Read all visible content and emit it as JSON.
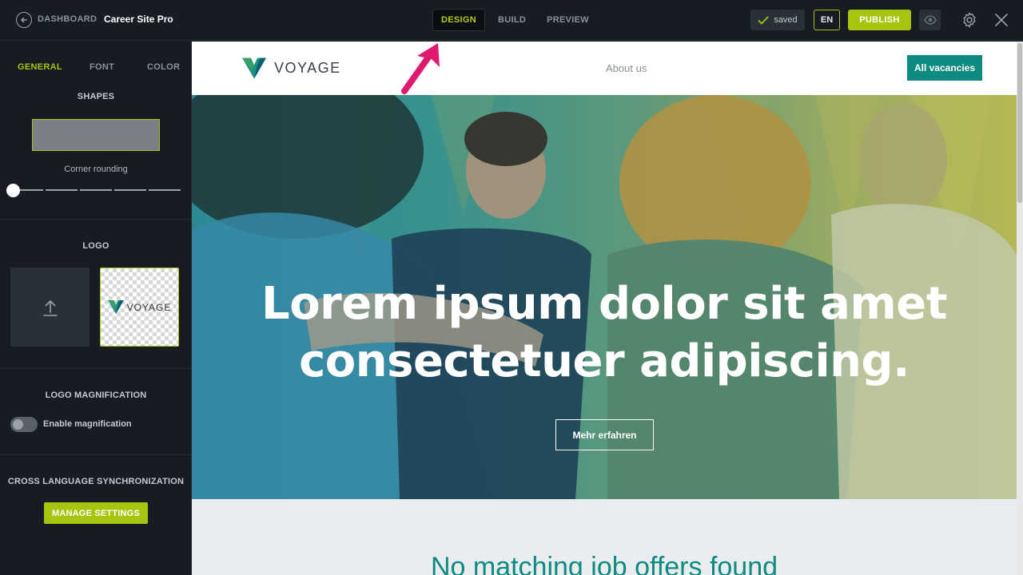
{
  "topbar": {
    "back_label": "DASHBOARD",
    "app_title": "Career Site Pro",
    "modes": [
      {
        "label": "DESIGN",
        "active": true
      },
      {
        "label": "BUILD",
        "active": false
      },
      {
        "label": "PREVIEW",
        "active": false
      }
    ],
    "saved_label": "saved",
    "language": "EN",
    "publish_label": "PUBLISH",
    "icons": [
      "back-arrow-icon",
      "check-icon",
      "eye-icon",
      "gear-icon",
      "close-icon"
    ]
  },
  "sidebar": {
    "tabs": [
      {
        "label": "GENERAL",
        "active": true
      },
      {
        "label": "FONT",
        "active": false
      },
      {
        "label": "COLOR",
        "active": false
      }
    ],
    "shapes_title": "SHAPES",
    "corner_rounding_label": "Corner rounding",
    "corner_rounding_value": 0,
    "logo_title": "LOGO",
    "logo_preview_text": "VOYAGE",
    "magnification_title": "LOGO MAGNIFICATION",
    "magnification_toggle_label": "Enable magnification",
    "magnification_enabled": false,
    "sync_title": "CROSS LANGUAGE SYNCHRONIZATION",
    "manage_settings_label": "MANAGE SETTINGS"
  },
  "preview": {
    "logo_text": "VOYAGE",
    "nav_about": "About us",
    "vacancies_button": "All vacancies",
    "hero_line1": "Lorem ipsum dolor sit amet",
    "hero_line2": "consectetuer adipiscing.",
    "hero_button": "Mehr erfahren",
    "jobs_heading": "No matching job offers found"
  },
  "colors": {
    "accent": "#a7c40f",
    "teal": "#0f8a80",
    "dark_bg": "#171c22",
    "annotation_arrow": "#e0186f"
  }
}
